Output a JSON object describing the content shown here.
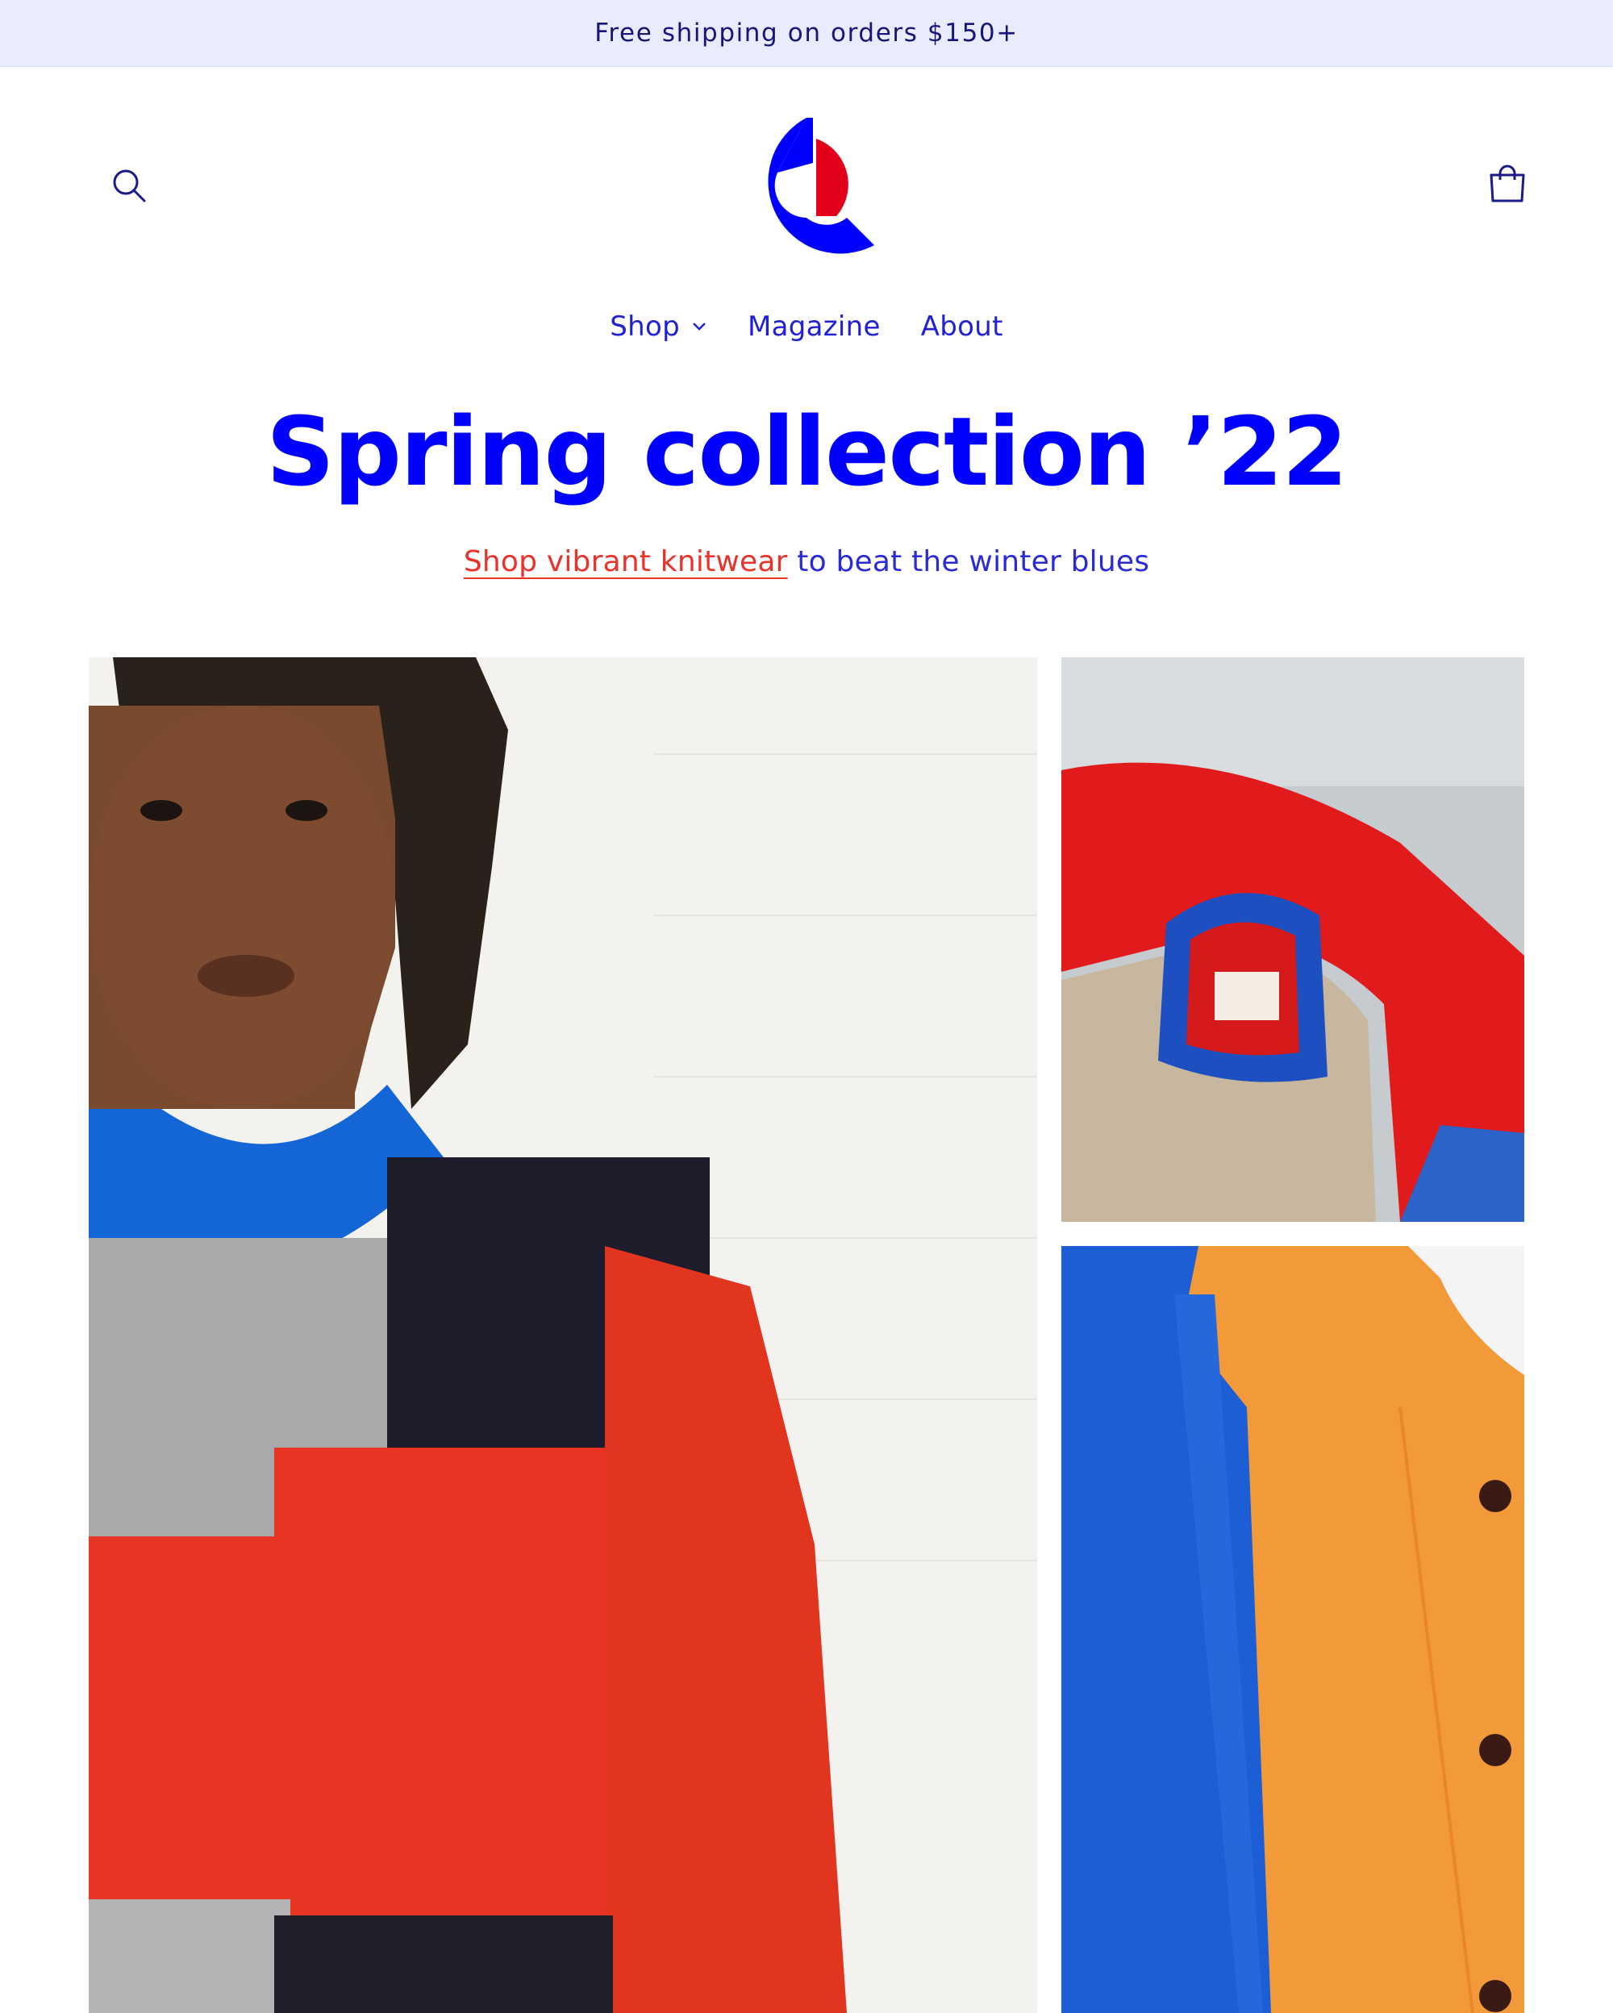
{
  "announcement": {
    "text": "Free shipping on orders $150+"
  },
  "header": {
    "search_icon": "search-icon",
    "cart_icon": "cart-icon",
    "logo_colors": {
      "primary": "#0000ff",
      "accent": "#e3001b"
    }
  },
  "nav": {
    "items": [
      {
        "label": "Shop",
        "has_dropdown": true
      },
      {
        "label": "Magazine"
      },
      {
        "label": "About"
      }
    ]
  },
  "hero": {
    "title": "Spring collection ’22",
    "subtitle_link": "Shop vibrant knitwear",
    "subtitle_rest": " to beat the winter blues"
  },
  "colors": {
    "link": "#e8322a",
    "heading": "#0000ff",
    "nav": "#2020d6",
    "announcement_bg": "#e8ecfd"
  }
}
